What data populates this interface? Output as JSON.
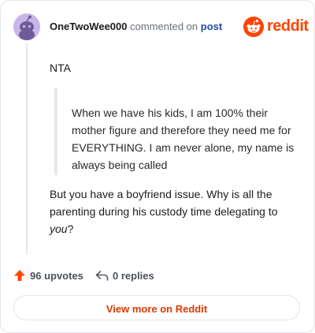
{
  "header": {
    "author": "OneTwoWee000",
    "action_text": "commented on",
    "post_link": "post"
  },
  "logo": {
    "text": "reddit",
    "icon": "reddit-snoo-icon"
  },
  "comment": {
    "first_line": "NTA",
    "quote": "When we have his kids, I am 100% their mother figure and therefore they need me for EVERYTHING. I am never alone, my name is always being called",
    "paragraph_main": "But you have a boyfriend issue. Why is all the parenting during his custody time delegating to ",
    "paragraph_emphasis": "you",
    "paragraph_end": "?"
  },
  "footer": {
    "upvotes_label": "96 upvotes",
    "replies_label": "0 replies",
    "upvote_icon": "upvote-arrow-icon",
    "reply_icon": "reply-arrow-icon"
  },
  "view_more_label": "View more on Reddit",
  "colors": {
    "accent": "#ff4500",
    "link": "#1d4ea8",
    "view_more": "#d93a00"
  }
}
